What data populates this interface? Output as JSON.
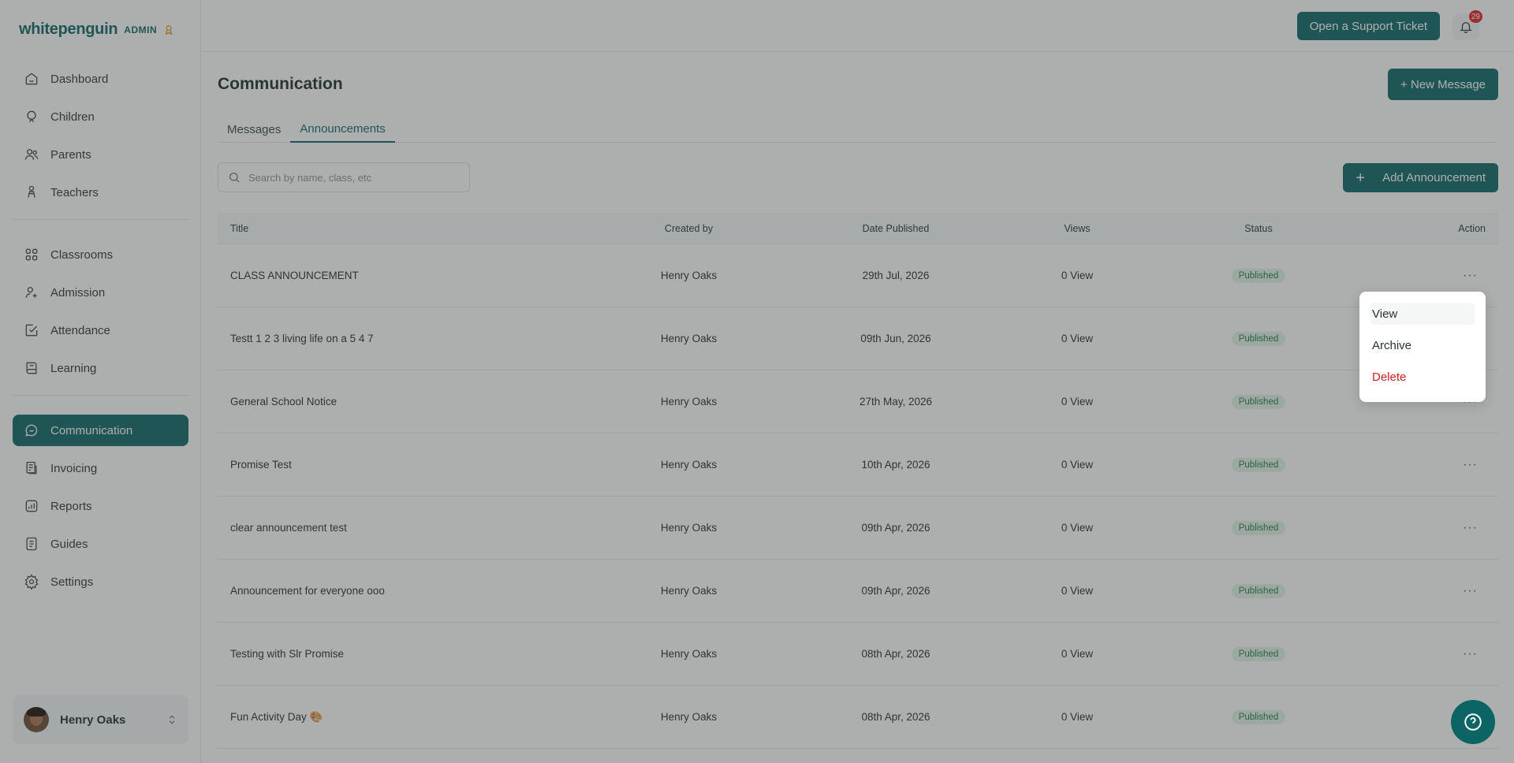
{
  "brand": {
    "name": "whitepenguin",
    "role": "ADMIN"
  },
  "sidebar": {
    "groups": [
      [
        {
          "label": "Dashboard",
          "icon": "home-icon"
        },
        {
          "label": "Children",
          "icon": "child-icon"
        },
        {
          "label": "Parents",
          "icon": "users-icon"
        },
        {
          "label": "Teachers",
          "icon": "teacher-icon"
        }
      ],
      [
        {
          "label": "Classrooms",
          "icon": "grid-icon"
        },
        {
          "label": "Admission",
          "icon": "user-add-icon"
        },
        {
          "label": "Attendance",
          "icon": "check-square-icon"
        },
        {
          "label": "Learning",
          "icon": "book-icon"
        }
      ],
      [
        {
          "label": "Communication",
          "icon": "chat-icon",
          "active": true
        },
        {
          "label": "Invoicing",
          "icon": "invoice-icon"
        },
        {
          "label": "Reports",
          "icon": "chart-icon"
        },
        {
          "label": "Guides",
          "icon": "document-icon"
        },
        {
          "label": "Settings",
          "icon": "gear-icon"
        }
      ]
    ],
    "user": {
      "name": "Henry Oaks"
    }
  },
  "topbar": {
    "support_label": "Open a Support Ticket",
    "notification_count": "29"
  },
  "main": {
    "title": "Communication",
    "new_message_label": "+ New Message",
    "tabs": [
      "Messages",
      "Announcements"
    ],
    "active_tab": 1,
    "search_placeholder": "Search by name, class, etc",
    "add_label": "Add Announcement",
    "columns": [
      "Title",
      "Created by",
      "Date Published",
      "Views",
      "Status",
      "Action"
    ],
    "rows": [
      {
        "title": "CLASS ANNOUNCEMENT",
        "created_by": "Henry Oaks",
        "date": "29th Jul, 2026",
        "views": "0 View",
        "status": "Published"
      },
      {
        "title": "Testt 1 2 3 living life on a 5 4 7",
        "created_by": "Henry Oaks",
        "date": "09th Jun, 2026",
        "views": "0 View",
        "status": "Published"
      },
      {
        "title": "General School Notice",
        "created_by": "Henry Oaks",
        "date": "27th May, 2026",
        "views": "0 View",
        "status": "Published"
      },
      {
        "title": "Promise Test",
        "created_by": "Henry Oaks",
        "date": "10th Apr, 2026",
        "views": "0 View",
        "status": "Published"
      },
      {
        "title": "clear announcement test",
        "created_by": "Henry Oaks",
        "date": "09th Apr, 2026",
        "views": "0 View",
        "status": "Published"
      },
      {
        "title": "Announcement for everyone ooo",
        "created_by": "Henry Oaks",
        "date": "09th Apr, 2026",
        "views": "0 View",
        "status": "Published"
      },
      {
        "title": "Testing with Slr Promise",
        "created_by": "Henry Oaks",
        "date": "08th Apr, 2026",
        "views": "0 View",
        "status": "Published"
      },
      {
        "title": "Fun Activity Day 🎨",
        "created_by": "Henry Oaks",
        "date": "08th Apr, 2026",
        "views": "0 View",
        "status": "Published"
      }
    ]
  },
  "action_menu": {
    "items": [
      "View",
      "Archive",
      "Delete"
    ]
  },
  "colors": {
    "brand": "#0d6464",
    "danger": "#d01f1f",
    "published_text": "#1f7a40",
    "published_bg": "#e2f3e8"
  }
}
